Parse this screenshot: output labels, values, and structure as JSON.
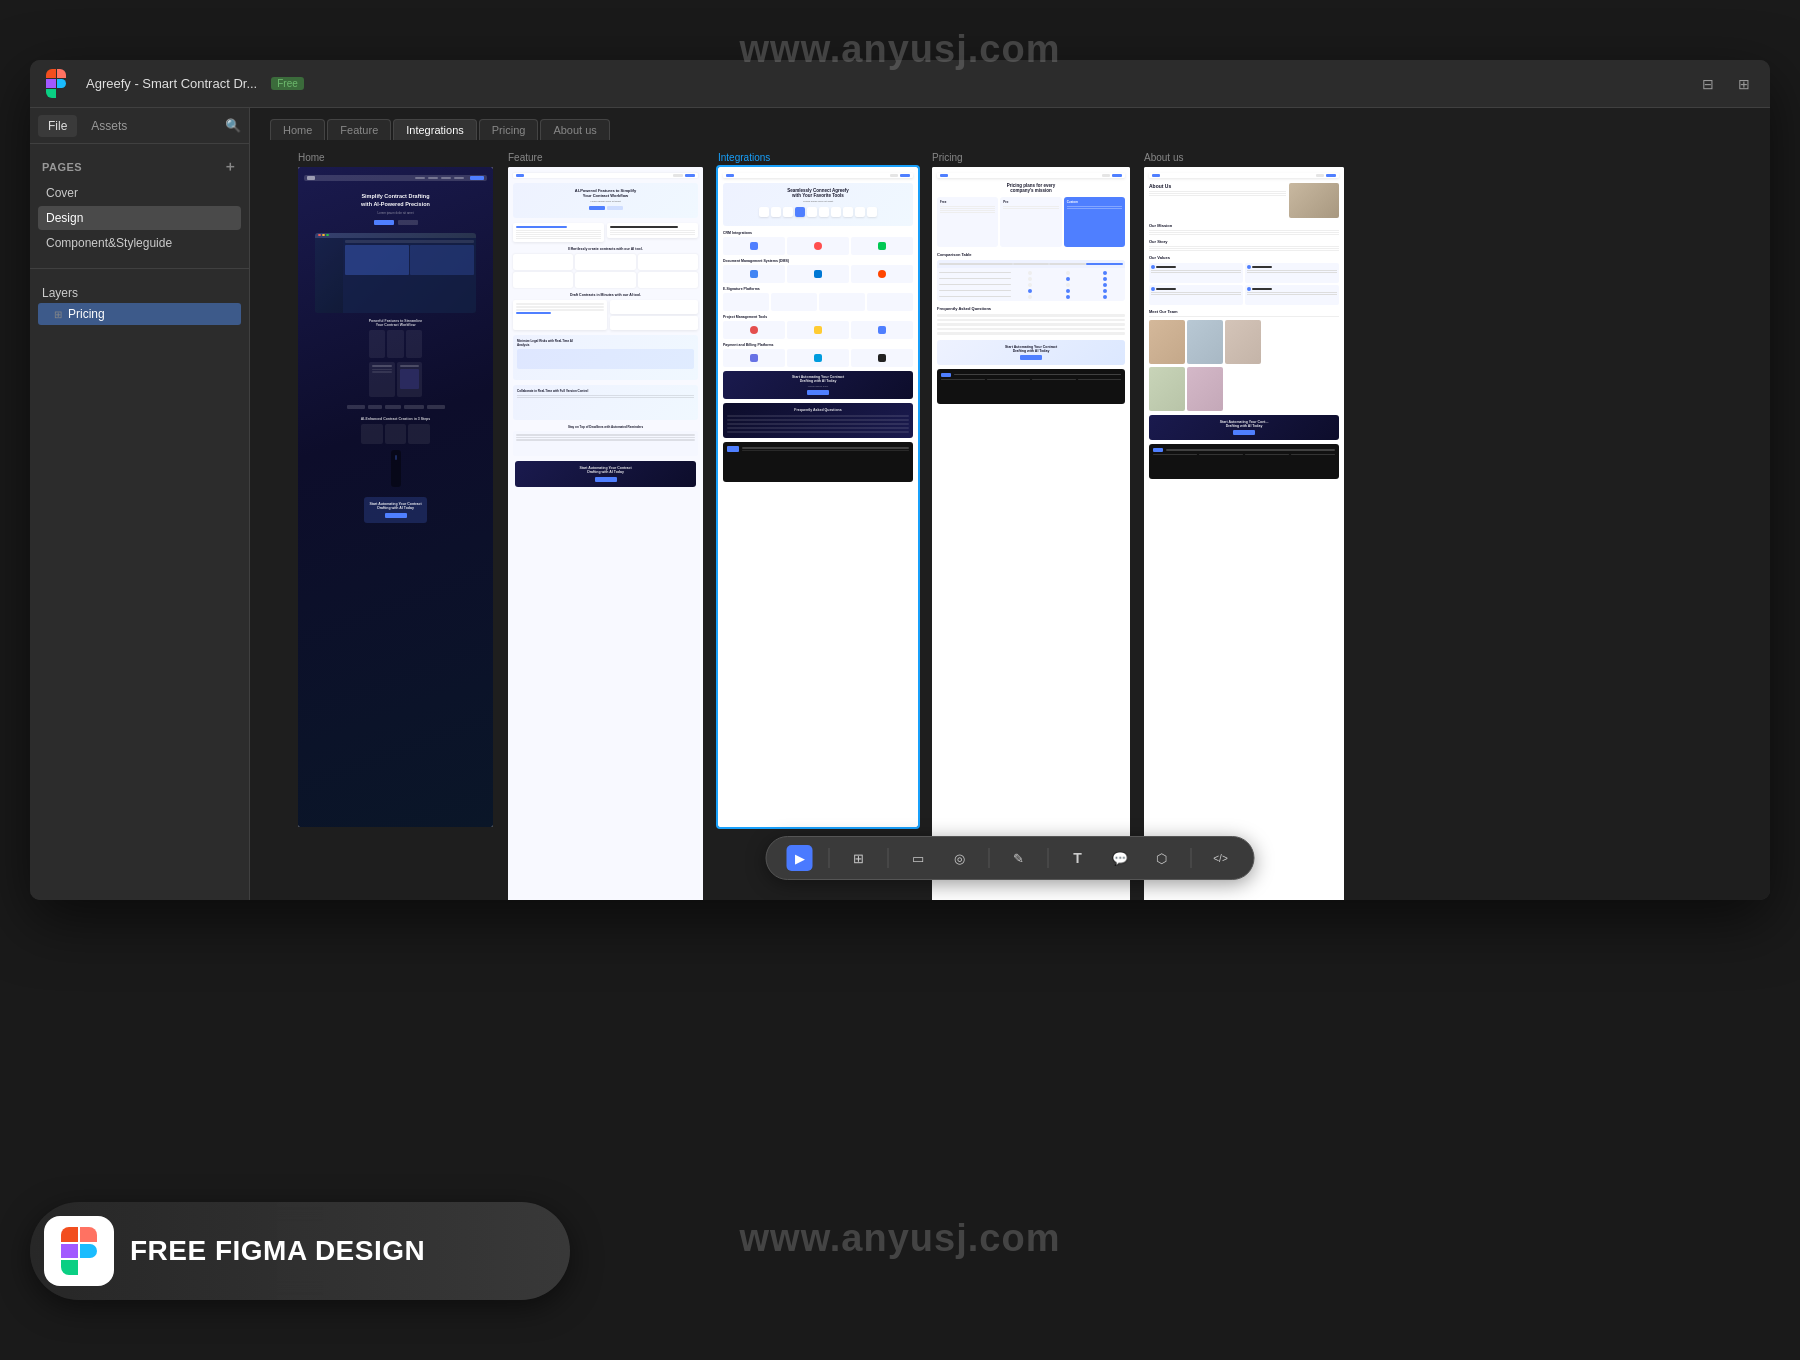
{
  "watermark": {
    "text": "www.anyusj.com"
  },
  "app": {
    "title": "Agreefy - Smart Contract Dr...",
    "badge": "Free",
    "logo_icon": "figma-icon"
  },
  "toolbar": {
    "panels_icon": "panels-icon",
    "expand_icon": "expand-icon"
  },
  "sidebar": {
    "file_tab": "File",
    "assets_tab": "Assets",
    "search_icon": "search-icon",
    "pages_section": "Pages",
    "add_page_icon": "add-page-icon",
    "pages": [
      {
        "label": "Cover",
        "active": false
      },
      {
        "label": "Design",
        "active": true
      },
      {
        "label": "Component&Styleguide",
        "active": false
      }
    ],
    "layers_section": "Layers",
    "layer_items": [
      {
        "label": "Pricing",
        "icon": "grid-icon",
        "active": false
      }
    ]
  },
  "canvas": {
    "page_tabs": [
      {
        "label": "Home",
        "active": false
      },
      {
        "label": "Feature",
        "active": false
      },
      {
        "label": "Integrations",
        "active": true
      },
      {
        "label": "Pricing",
        "active": false
      },
      {
        "label": "About us",
        "active": false
      }
    ]
  },
  "free_design": {
    "label": "FREE FIGMA DESIGN",
    "icon": "figma-large-icon"
  },
  "toolbar_tools": [
    {
      "icon": "▶",
      "name": "select-tool",
      "active": true
    },
    {
      "icon": "⊞",
      "name": "frame-tool",
      "active": false
    },
    {
      "icon": "▭",
      "name": "rect-tool",
      "active": false
    },
    {
      "icon": "◎",
      "name": "ellipse-tool",
      "active": false
    },
    {
      "icon": "✏",
      "name": "pen-tool",
      "active": false
    },
    {
      "icon": "T",
      "name": "text-tool",
      "active": false
    },
    {
      "icon": "💬",
      "name": "comment-tool",
      "active": false
    },
    {
      "icon": "⬡",
      "name": "component-tool",
      "active": false
    },
    {
      "icon": "</>",
      "name": "code-tool",
      "active": false
    }
  ]
}
